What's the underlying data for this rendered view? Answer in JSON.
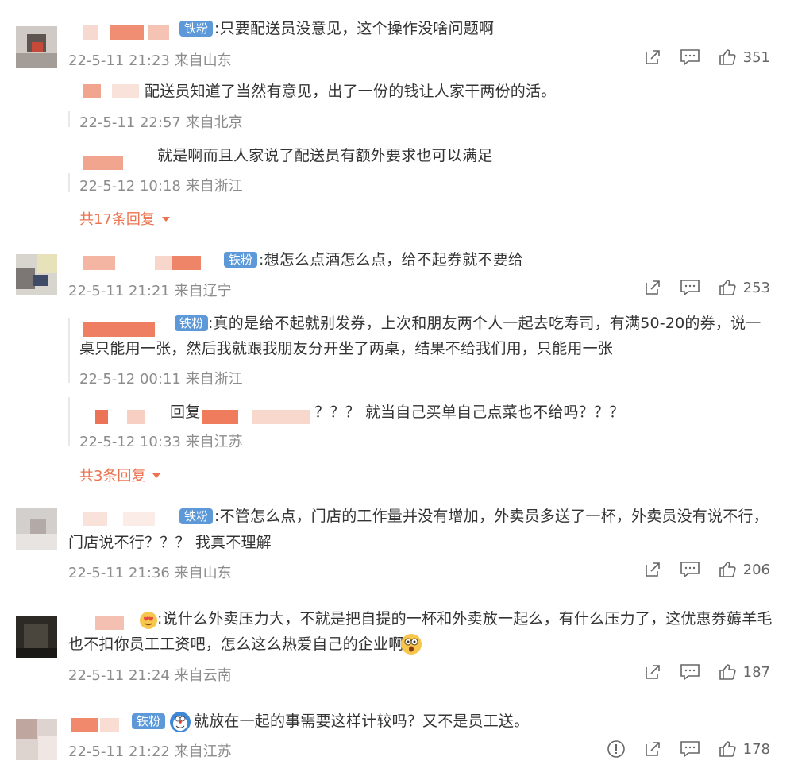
{
  "badge": "铁粉",
  "comments": [
    {
      "text": ":只要配送员没意见，这个操作没啥问题啊",
      "meta": "22-5-11 21:23 来自山东",
      "likes": "351",
      "replies": [
        {
          "text": "配送员知道了当然有意见，出了一份的钱让人家干两份的活。",
          "meta": "22-5-11 22:57 来自北京"
        },
        {
          "text": "就是啊而且人家说了配送员有额外要求也可以满足",
          "meta": "22-5-12 10:18 来自浙江"
        }
      ],
      "more": "共17条回复"
    },
    {
      "text": ":想怎么点酒怎么点，给不起券就不要给",
      "meta": "22-5-11 21:21 来自辽宁",
      "likes": "253",
      "replies": [
        {
          "text_l1": ":真的是给不起就别发券，上次和朋友两个人一起去吃寿司，有满50-20的券，说一",
          "text_l2": "桌只能用一张，然后我就跟我朋友分开坐了两桌，结果不给我们用，只能用一张",
          "meta": "22-5-12 00:11 来自浙江"
        },
        {
          "prefix": "回复",
          "text": "？？？ 就当自己买单自己点菜也不给吗？？？",
          "meta": "22-5-12 10:33 来自江苏"
        }
      ],
      "more": "共3条回复"
    },
    {
      "text_l1": ":不管怎么点，门店的工作量并没有增加，外卖员多送了一杯，外卖员没有说不行，",
      "text_l2": "门店说不行？？？ 我真不理解",
      "meta": "22-5-11 21:36 来自山东",
      "likes": "206"
    },
    {
      "text_l1": ":说什么外卖压力大，不就是把自提的一杯和外卖放一起么，有什么压力了，这优惠券薅羊毛",
      "text_l2": "也不扣你员工工资吧，怎么这么热爱自己的企业啊",
      "meta": "22-5-11 21:24 来自云南",
      "likes": "187"
    },
    {
      "text": "就放在一起的事需要这样计较吗？又不是员工送。",
      "meta": "22-5-11 21:22 来自江苏",
      "likes": "178"
    }
  ],
  "colors": {
    "accent": "#eb7350",
    "badge": "#5d99d8",
    "meta": "#8c8c8c"
  },
  "icons": [
    "share-icon",
    "comment-icon",
    "like-icon",
    "report-icon",
    "dropdown-arrow-icon"
  ]
}
